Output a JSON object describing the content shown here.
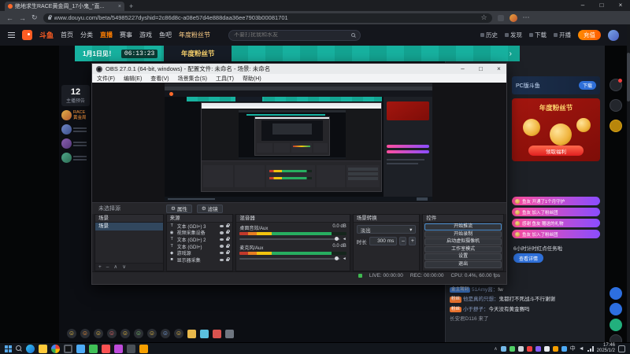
{
  "colors": {
    "accent_orange": "#ff5d23",
    "active_nav": "#ff7e00",
    "teal_banner": "#17b2a0",
    "gift_pink": "#ff4f9e",
    "gift_purple": "#8a4dff",
    "promo_red": "#a4160f",
    "meter_green": "#27ae60",
    "live_green": "#3fb950"
  },
  "browser": {
    "tab_title": "绝地求生RACE黄金周_17小鬼_\"直...",
    "url": "www.douyu.com/beta/54985227dyshid=2c86d8c-a08e57d4e888daa36ee7903b00081701",
    "icons": {
      "back": "←",
      "forward": "→",
      "refresh": "↻",
      "bookmark": "☆",
      "more": "⋯",
      "newtab": "+",
      "minimize": "–",
      "maximize": "□",
      "close": "×",
      "tab_close": "×"
    }
  },
  "site": {
    "logo_text": "斗鱼",
    "nav": [
      {
        "label": "首页"
      },
      {
        "label": "分类"
      },
      {
        "label": "直播"
      },
      {
        "label": "赛事"
      },
      {
        "label": "游戏"
      },
      {
        "label": "鱼吧"
      },
      {
        "label": "年度粉丝节"
      }
    ],
    "search_placeholder": "不要打扰我和水友",
    "user_actions": [
      {
        "label": "历史"
      },
      {
        "label": "发现"
      },
      {
        "label": "下载"
      },
      {
        "label": "开播"
      }
    ],
    "recharge_label": "充值",
    "banner": {
      "left_text": "1月1日见！",
      "timer": "06:13:23",
      "center_text": "年度粉丝节",
      "arrow": "›"
    },
    "left_rail": {
      "calendar_number": "12",
      "calendar_label": "主播预告",
      "first_item": "RACE黄金周"
    }
  },
  "obs": {
    "title": "OBS 27.0.1 (64-bit, windows) - 配置文件: 未命名 - 场景: 未命名",
    "controls_glyphs": {
      "minimize": "–",
      "maximize": "□",
      "close": "×"
    },
    "menus": [
      "文件(F)",
      "编辑(E)",
      "查看(V)",
      "场景集合(S)",
      "工具(T)",
      "帮助(H)"
    ],
    "context_label": "未选择源",
    "context_buttons": [
      "属性",
      "滤镜"
    ],
    "dock_toolbar": {
      "add": "+",
      "remove": "–",
      "props": "⚙",
      "up": "∧",
      "down": "∨",
      "caret": "▾"
    },
    "scenes": {
      "title": "场景",
      "items": [
        "场景"
      ]
    },
    "sources": {
      "title": "来源",
      "items": [
        {
          "icon": "T",
          "label": "文本 (GDI+) 3"
        },
        {
          "icon": "◉",
          "label": "视频采集设备"
        },
        {
          "icon": "T",
          "label": "文本 (GDI+) 2"
        },
        {
          "icon": "T",
          "label": "文本 (GDI+)"
        },
        {
          "icon": "◆",
          "label": "游戏源"
        },
        {
          "icon": "■",
          "label": "显示器采集"
        }
      ]
    },
    "mixer": {
      "title": "混音器",
      "channels": [
        {
          "name": "桌面音效/Aux",
          "db": "0.0 dB"
        },
        {
          "name": "麦克风/Aux",
          "db": "0.0 dB"
        }
      ]
    },
    "transitions": {
      "title": "场景转换",
      "transition": "淡出",
      "duration_label": "时长",
      "duration": "300 ms"
    },
    "controls": {
      "title": "控件",
      "buttons": [
        "开始推流",
        "开始录制",
        "启动虚拟摄像机",
        "工作室模式",
        "设置",
        "退出"
      ]
    },
    "status": {
      "live": "LIVE: 00:00:00",
      "rec": "REC: 00:00:00",
      "cpu": "CPU: 0.4%, 60.00 fps"
    }
  },
  "chat": {
    "pc_banner": {
      "text": "PC版斗鱼",
      "button": "下载"
    },
    "promo": {
      "title": "年度粉丝节",
      "button": "领取福利"
    },
    "gift_banners": [
      {
        "text": "鱼友 开通了1个月守护"
      },
      {
        "text": "鱼友 加入了粉丝团"
      },
      {
        "text": "感谢 鱼友 赠送的礼物"
      },
      {
        "text": "鱼友 加入了粉丝团"
      }
    ],
    "notice_text": "6小时计时红点任务啦",
    "notice_button": "查看详情",
    "messages": [
      {
        "badge": "金主驾到",
        "user": "51Amy酱：",
        "text": "fw"
      },
      {
        "badge": "粉丝",
        "user": "他是真的只想：",
        "text": "鬼都打不死战斗不行谢谢"
      },
      {
        "badge": "粉丝",
        "user": "小于舒子：",
        "text": "今天没有黄金赛吗"
      },
      {
        "system_text": "长安君D116 来了"
      }
    ]
  },
  "ui": {
    "emoji_bar": [
      "☺",
      "☺",
      "☺",
      "☺",
      "☺",
      "☺",
      "☺",
      "☺",
      "☺"
    ]
  },
  "taskbar": {
    "left_icon_names": [
      "start",
      "search",
      "edge",
      "file-explorer",
      "chrome",
      "obs",
      "chat-app",
      "wechat",
      "media-app",
      "store-app",
      "game-app",
      "music-app"
    ],
    "tray_icon_names": [
      "obs-tray",
      "wechat-tray",
      "settings-tray",
      "security-tray",
      "cloud-tray",
      "update-tray",
      "audio-tray",
      "gpu-tray"
    ],
    "tray_expand": "∧",
    "lang": "中",
    "time": "17:46",
    "date": "2025/1/2"
  }
}
